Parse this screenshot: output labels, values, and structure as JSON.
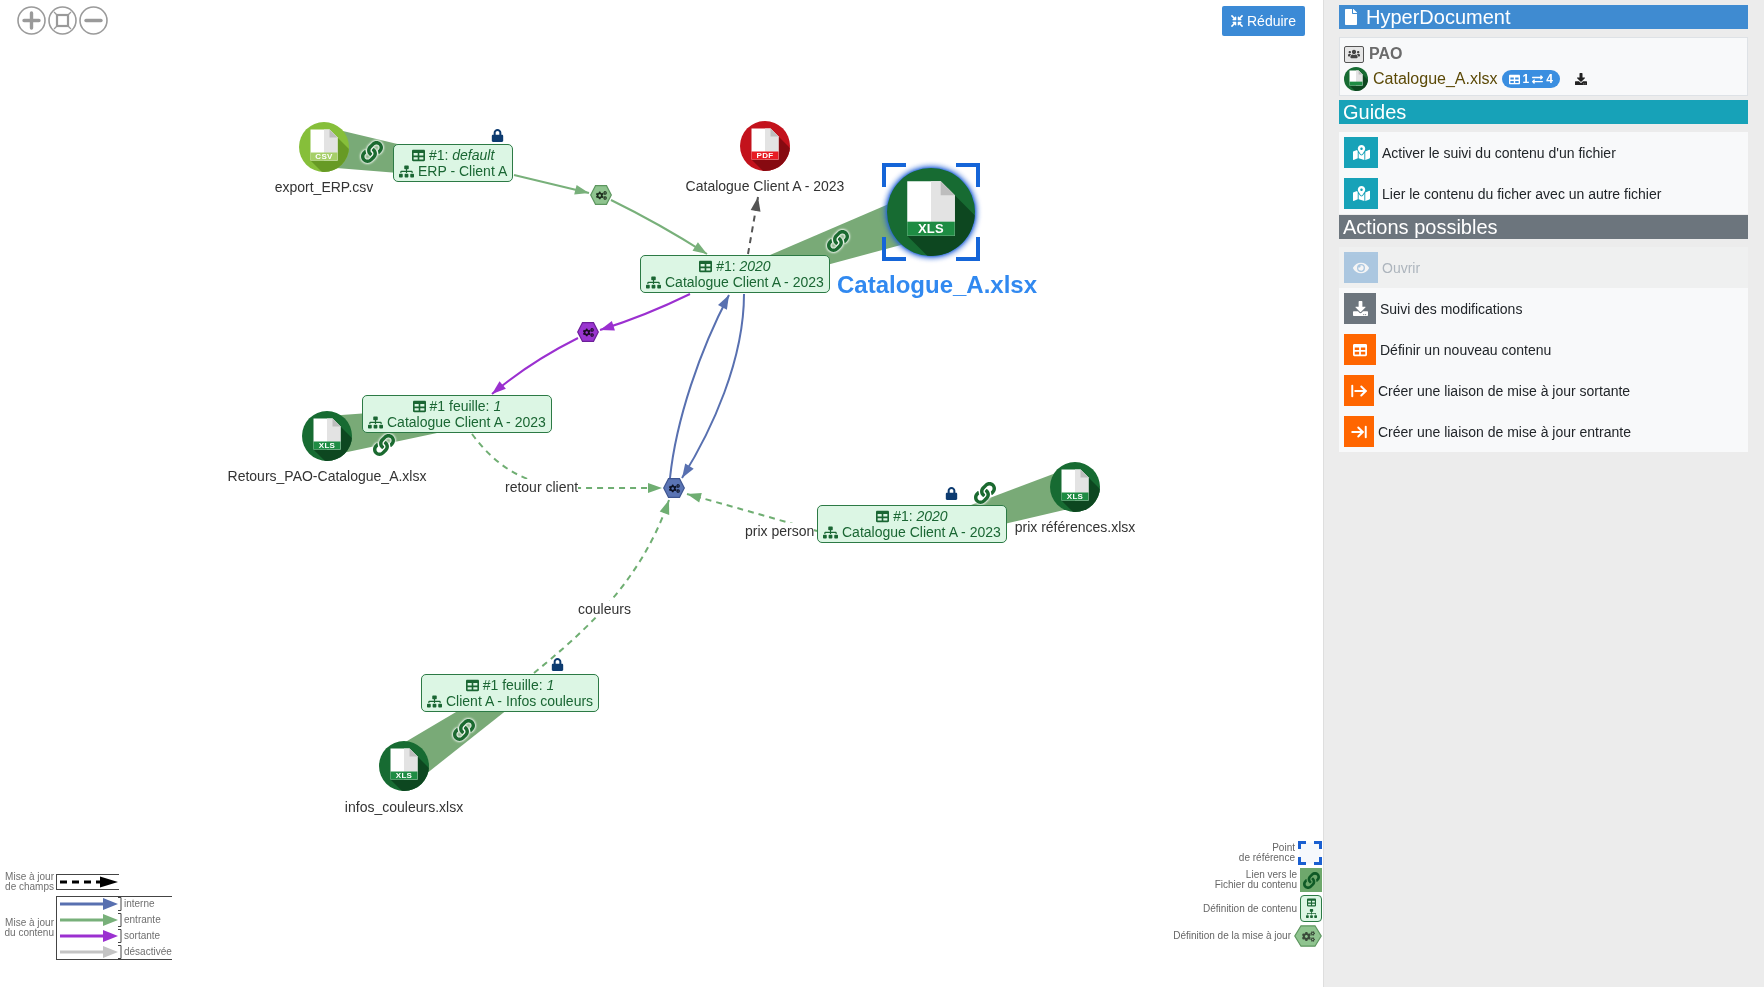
{
  "canvas": {
    "reduce_button": {
      "label": "Réduire"
    }
  },
  "graph": {
    "files": [
      {
        "name": "export_ERP.csv",
        "kind": "csv",
        "badge": "CSV",
        "selected": false
      },
      {
        "name": "Catalogue Client A - 2023",
        "kind": "pdf",
        "badge": "PDF",
        "selected": false
      },
      {
        "name": "Catalogue_A.xlsx",
        "kind": "xls",
        "badge": "XLS",
        "selected": true
      },
      {
        "name": "Retours_PAO-Catalogue_A.xlsx",
        "kind": "xls",
        "badge": "XLS",
        "selected": false
      },
      {
        "name": "prix références.xlsx",
        "kind": "xls",
        "badge": "XLS",
        "selected": false
      },
      {
        "name": "infos_couleurs.xlsx",
        "kind": "xls",
        "badge": "XLS",
        "selected": false
      }
    ],
    "contents": [
      {
        "sheet": "#1: *default*",
        "title": "ERP - Client A",
        "locked": true
      },
      {
        "sheet": "#1: *2020*",
        "title": "Catalogue Client A - 2023",
        "locked": false
      },
      {
        "sheet": "#1 feuille: *1*",
        "title": "Catalogue Client A - 2023",
        "locked": false
      },
      {
        "sheet": "#1: *2020*",
        "title": "Catalogue Client A - 2023",
        "locked": true
      },
      {
        "sheet": "#1 feuille: *1*",
        "title": "Client A - Infos couleurs",
        "locked": true
      }
    ],
    "updates": [
      {
        "kind": "entrante"
      },
      {
        "kind": "sortante"
      },
      {
        "kind": "interne"
      }
    ],
    "field_links": [
      {
        "label": "retour client"
      },
      {
        "label": "prix person"
      },
      {
        "label": "couleurs"
      }
    ]
  },
  "legend": {
    "field_update": {
      "label": "Mise à jour\nde champs"
    },
    "content_update": {
      "label": "Mise à jour\ndu contenu",
      "arrows": [
        {
          "kind": "interne",
          "label": "interne"
        },
        {
          "kind": "entrante",
          "label": "entrante"
        },
        {
          "kind": "sortante",
          "label": "sortante"
        },
        {
          "kind": "disabled",
          "label": "désactivée"
        }
      ]
    },
    "symbols": [
      {
        "kind": "reference",
        "label": "Point\nde référence"
      },
      {
        "kind": "file_link",
        "label": "Lien vers le\nFichier du contenu"
      },
      {
        "kind": "content",
        "label": "Définition de contenu"
      },
      {
        "kind": "update",
        "label": "Définition de la mise à jour"
      }
    ]
  },
  "panel": {
    "header": {
      "title": "HyperDocument"
    },
    "document": {
      "project": "PAO",
      "file": "Catalogue_A.xlsx",
      "content_count": "1",
      "link_count": "4"
    },
    "guides": {
      "title": "Guides",
      "items": [
        {
          "label": "Activer le suivi du contenu d'un fichier"
        },
        {
          "label": "Lier le contenu du ficher avec un autre fichier"
        }
      ]
    },
    "actions": {
      "title": "Actions possibles",
      "items": [
        {
          "kind": "open",
          "label": "Ouvrir",
          "disabled": true
        },
        {
          "kind": "history",
          "label": "Suivi des modifications",
          "disabled": false
        },
        {
          "kind": "new_content",
          "label": "Définir un nouveau contenu",
          "disabled": false
        },
        {
          "kind": "outgoing_link",
          "label": "Créer une liaison de mise à jour sortante",
          "disabled": false
        },
        {
          "kind": "incoming_link",
          "label": "Créer une liaison de mise à jour entrante",
          "disabled": false
        }
      ]
    }
  }
}
